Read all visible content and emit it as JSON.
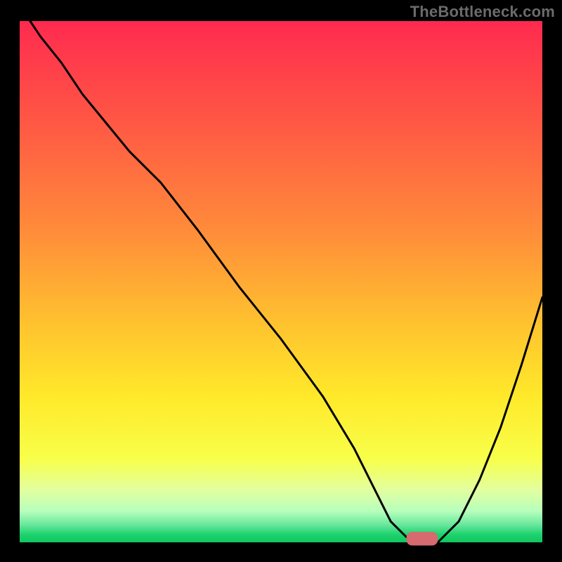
{
  "watermark": "TheBottleneck.com",
  "chart_data": {
    "type": "line",
    "title": "",
    "xlabel": "",
    "ylabel": "",
    "xlim": [
      0,
      100
    ],
    "ylim": [
      0,
      100
    ],
    "grid": false,
    "legend": false,
    "gradient_stops": [
      {
        "offset": 0.0,
        "color": "#ff2a4f"
      },
      {
        "offset": 0.2,
        "color": "#ff5944"
      },
      {
        "offset": 0.4,
        "color": "#ff8b3a"
      },
      {
        "offset": 0.58,
        "color": "#ffc22f"
      },
      {
        "offset": 0.72,
        "color": "#ffe92a"
      },
      {
        "offset": 0.84,
        "color": "#f8ff4a"
      },
      {
        "offset": 0.9,
        "color": "#e2ffa0"
      },
      {
        "offset": 0.94,
        "color": "#b7ffbc"
      },
      {
        "offset": 0.965,
        "color": "#6de89f"
      },
      {
        "offset": 0.985,
        "color": "#1ed26e"
      },
      {
        "offset": 1.0,
        "color": "#10c65e"
      }
    ],
    "series": [
      {
        "name": "bottleneck-curve",
        "x": [
          2,
          4,
          8,
          12,
          21,
          27,
          34,
          42,
          50,
          58,
          64,
          68,
          71,
          74,
          77,
          80,
          84,
          88,
          92,
          96,
          100
        ],
        "y": [
          100,
          97,
          92,
          86,
          75,
          69,
          60,
          49,
          39,
          28,
          18,
          10,
          4,
          1,
          0,
          0,
          4,
          12,
          22,
          34,
          47
        ]
      }
    ],
    "marker": {
      "x_start": 74,
      "x_end": 80,
      "y": 0.7,
      "color": "#d66a6f",
      "thickness": 2.6
    }
  }
}
